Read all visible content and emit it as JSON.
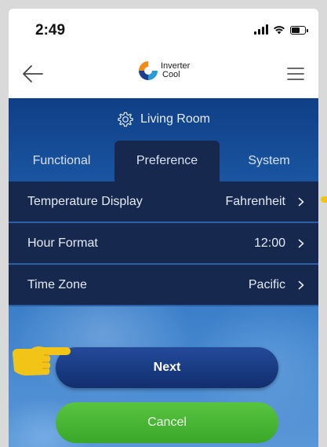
{
  "status_bar": {
    "time": "2:49",
    "icons": [
      "cellular-signal-icon",
      "wifi-icon",
      "battery-icon"
    ]
  },
  "nav_bar": {
    "back_icon": "arrow-left-icon",
    "logo_text_line1": "Inverter",
    "logo_text_line2": "Cool",
    "menu_icon": "hamburger-menu-icon"
  },
  "room": {
    "icon": "gear-icon",
    "name": "Living Room"
  },
  "tabs": [
    {
      "label": "Functional",
      "active": false
    },
    {
      "label": "Preference",
      "active": true
    },
    {
      "label": "System",
      "active": false
    }
  ],
  "settings": [
    {
      "label": "Temperature Display",
      "value": "Fahrenheit"
    },
    {
      "label": "Hour Format",
      "value": "12:00"
    },
    {
      "label": "Time Zone",
      "value": "Pacific"
    }
  ],
  "buttons": {
    "next_label": "Next",
    "cancel_label": "Cancel"
  },
  "annotations": {
    "pointer_icon": "pointing-hand-icon"
  },
  "colors": {
    "panel_dark": "#17284f",
    "accent_blue": "#1f5fae",
    "next_button": "#1a3c84",
    "cancel_button": "#48b535",
    "pointer_yellow": "#f2c418"
  }
}
